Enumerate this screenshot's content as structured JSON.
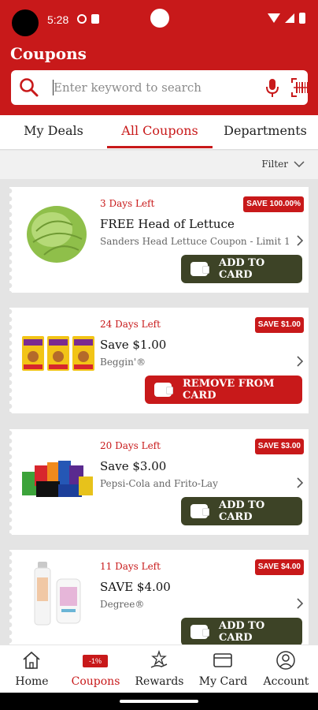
{
  "status_bar": {
    "time": "5:28"
  },
  "app": {
    "title": "Coupons"
  },
  "search": {
    "placeholder": "Enter keyword to search"
  },
  "tabs": [
    {
      "label": "My Deals"
    },
    {
      "label": "All Coupons"
    },
    {
      "label": "Departments"
    }
  ],
  "filter": {
    "label": "Filter"
  },
  "coupons": [
    {
      "days_left": "3 Days Left",
      "badge": "SAVE 100.00%",
      "title": "FREE Head of Lettuce",
      "subtitle": "Sanders Head Lettuce Coupon - Limit 1",
      "action": "ADD TO CARD"
    },
    {
      "days_left": "24 Days Left",
      "badge": "SAVE $1.00",
      "title": "Save $1.00",
      "subtitle": "Beggin'®",
      "action": "REMOVE FROM CARD"
    },
    {
      "days_left": "20 Days Left",
      "badge": "SAVE $3.00",
      "title": "Save $3.00",
      "subtitle": "Pepsi-Cola and Frito-Lay",
      "action": "ADD TO CARD"
    },
    {
      "days_left": "11 Days Left",
      "badge": "SAVE $4.00",
      "title": "SAVE $4.00",
      "subtitle": "Degree®",
      "action": "ADD TO CARD"
    }
  ],
  "bottom_nav": [
    {
      "label": "Home",
      "icon": "house-icon"
    },
    {
      "label": "Coupons",
      "icon": "coupon-tag-icon",
      "tag": "-1%"
    },
    {
      "label": "Rewards",
      "icon": "star-hand-icon"
    },
    {
      "label": "My Card",
      "icon": "card-icon"
    },
    {
      "label": "Account",
      "icon": "person-icon"
    }
  ],
  "colors": {
    "brand_red": "#c8191a",
    "add_button": "#3d4326"
  }
}
